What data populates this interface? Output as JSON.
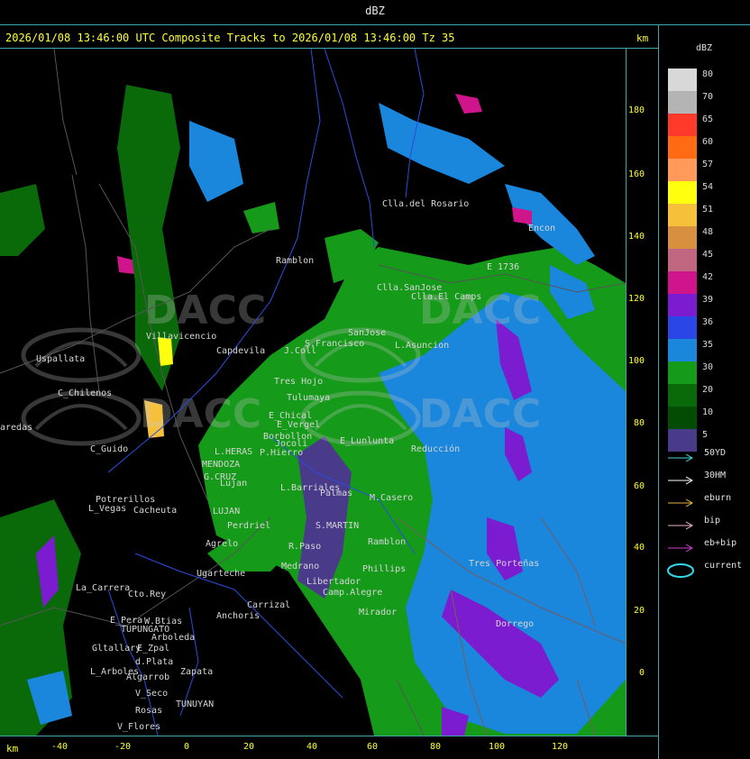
{
  "window": {
    "top_title": "dBZ",
    "header": "2026/01/08 13:46:00 UTC Composite Tracks to 2026/01/08 13:46:00 Tz 35",
    "km_top": "km",
    "km_bottom": "km"
  },
  "axes": {
    "y_ticks": [
      "180",
      "160",
      "140",
      "120",
      "100",
      "80",
      "60",
      "40",
      "20",
      "0"
    ],
    "x_ticks": [
      "-40",
      "-20",
      "0",
      "20",
      "40",
      "60",
      "80",
      "100",
      "120"
    ]
  },
  "legend": {
    "title": "dBZ",
    "scale": [
      {
        "value": "80",
        "color": "#d8d8d8"
      },
      {
        "value": "70",
        "color": "#b4b4b4"
      },
      {
        "value": "65",
        "color": "#ff3a2a"
      },
      {
        "value": "60",
        "color": "#ff6a12"
      },
      {
        "value": "57",
        "color": "#ff9a5a"
      },
      {
        "value": "54",
        "color": "#ffff10"
      },
      {
        "value": "51",
        "color": "#f7c03a"
      },
      {
        "value": "48",
        "color": "#d8903e"
      },
      {
        "value": "45",
        "color": "#c06680"
      },
      {
        "value": "42",
        "color": "#d0148c"
      },
      {
        "value": "39",
        "color": "#7c1cd0"
      },
      {
        "value": "36",
        "color": "#2a46e6"
      },
      {
        "value": "35",
        "color": "#1a86dc"
      },
      {
        "value": "30",
        "color": "#159a1a"
      },
      {
        "value": "20",
        "color": "#0a6a0a"
      },
      {
        "value": "10",
        "color": "#034c03"
      },
      {
        "value": "5",
        "color": "#4a3a8a"
      }
    ],
    "tracks": [
      {
        "label": "50YD",
        "color": "#44d4d4"
      },
      {
        "label": "30HM",
        "color": "#ffffff"
      },
      {
        "label": "eburn",
        "color": "#e8b040"
      },
      {
        "label": "bip",
        "color": "#f2b0cc"
      },
      {
        "label": "eb+bip",
        "color": "#d040d0"
      },
      {
        "label": "current",
        "color": "#30d8e8"
      }
    ]
  },
  "places": [
    {
      "name": "Clla.del Rosario"
    },
    {
      "name": "Encon"
    },
    {
      "name": "E 1736"
    },
    {
      "name": "Ramblon"
    },
    {
      "name": "Clla.SanJose"
    },
    {
      "name": "Clla.El Camps"
    },
    {
      "name": "Villavicencio"
    },
    {
      "name": "Capdevila"
    },
    {
      "name": "J.Coll"
    },
    {
      "name": "S.Francisco"
    },
    {
      "name": "SanJose"
    },
    {
      "name": "L.Asuncion"
    },
    {
      "name": "Uspallata"
    },
    {
      "name": "Tres Hojo"
    },
    {
      "name": "C_Chilenos"
    },
    {
      "name": "Tulumaya"
    },
    {
      "name": "E_Chical"
    },
    {
      "name": "E_Vergel"
    },
    {
      "name": "Borbollon"
    },
    {
      "name": "Jocoli"
    },
    {
      "name": "aredas"
    },
    {
      "name": "C_Guido"
    },
    {
      "name": "L.HERAS"
    },
    {
      "name": "P.Hierro"
    },
    {
      "name": "MENDOZA"
    },
    {
      "name": "E_Lunlunta"
    },
    {
      "name": "G.CRUZ"
    },
    {
      "name": "Lujan"
    },
    {
      "name": "L.Barriales"
    },
    {
      "name": "Palmas"
    },
    {
      "name": "M.Casero"
    },
    {
      "name": "Potrerillos"
    },
    {
      "name": "L_Vegas"
    },
    {
      "name": "Cacheuta"
    },
    {
      "name": "LUJAN"
    },
    {
      "name": "Perdriel"
    },
    {
      "name": "S.MARTIN"
    },
    {
      "name": "Agrelo"
    },
    {
      "name": "R.Paso"
    },
    {
      "name": "Ramblon"
    },
    {
      "name": "Ugarteche"
    },
    {
      "name": "Medrano"
    },
    {
      "name": "Phillips"
    },
    {
      "name": "Libertador"
    },
    {
      "name": "Camp.Alegre"
    },
    {
      "name": "La_Carrera"
    },
    {
      "name": "Cto.Rey"
    },
    {
      "name": "Anchoris"
    },
    {
      "name": "Carrizal"
    },
    {
      "name": "Mirador"
    },
    {
      "name": "E_Pera"
    },
    {
      "name": "W.Btias"
    },
    {
      "name": "TUPUNGATO"
    },
    {
      "name": "Arboleda"
    },
    {
      "name": "Gltallary"
    },
    {
      "name": "E_Zpal"
    },
    {
      "name": "d.Plata"
    },
    {
      "name": "L_Arboles"
    },
    {
      "name": "Zapata"
    },
    {
      "name": "Algarrob"
    },
    {
      "name": "V_Seco"
    },
    {
      "name": "TUNUYAN"
    },
    {
      "name": "Rosas"
    },
    {
      "name": "V_Flores"
    },
    {
      "name": "Dorrego"
    },
    {
      "name": "Tres Porteñas"
    },
    {
      "name": "Reducción"
    }
  ]
}
